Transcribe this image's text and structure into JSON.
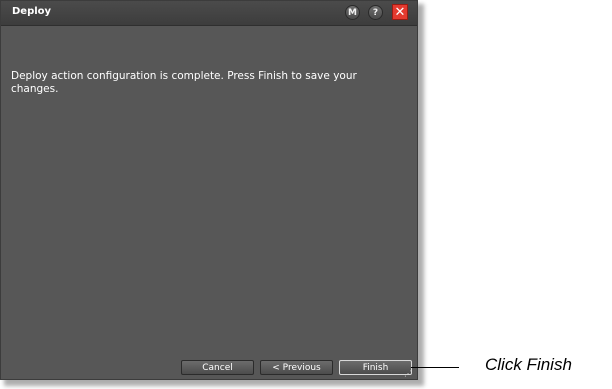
{
  "window": {
    "title": "Deploy",
    "buttons": {
      "m_label": "M",
      "help_label": "?",
      "close_label": "✕"
    }
  },
  "message": "Deploy action configuration is complete.  Press Finish to save your changes.",
  "footer": {
    "cancel_label": "Cancel",
    "previous_label": "< Previous",
    "finish_label": "Finish"
  },
  "annotation": {
    "text": "Click Finish"
  },
  "colors": {
    "window_bg": "#575757",
    "titlebar_bg": "#3d3d3d",
    "close_bg": "#e43a2f",
    "text": "#ffffff"
  }
}
